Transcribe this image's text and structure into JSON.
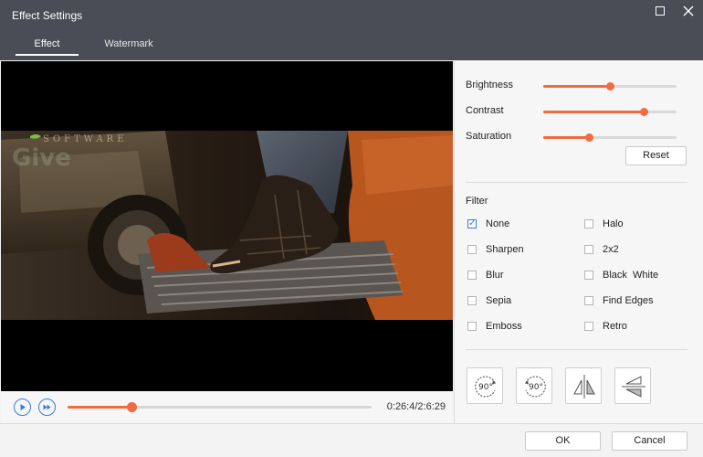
{
  "window": {
    "title": "Effect Settings",
    "maximize_icon": "maximize-icon",
    "close_icon": "close-icon"
  },
  "tabs": [
    {
      "label": "Effect",
      "active": true
    },
    {
      "label": "Watermark",
      "active": false
    }
  ],
  "watermark_overlay": {
    "text": "SOFTWARE",
    "accent": "#7bbf3a"
  },
  "player": {
    "play_icon": "play-icon",
    "step_icon": "step-forward-icon",
    "progress": 0.21,
    "time": "0:26:4/2:6:29"
  },
  "adjustments": {
    "brightness": {
      "label": "Brightness",
      "value": 0.5
    },
    "contrast": {
      "label": "Contrast",
      "value": 0.75
    },
    "saturation": {
      "label": "Saturation",
      "value": 0.34
    },
    "reset_label": "Reset"
  },
  "filter": {
    "heading": "Filter",
    "items": [
      {
        "label": "None",
        "checked": true
      },
      {
        "label": "Halo",
        "checked": false
      },
      {
        "label": "Sharpen",
        "checked": false
      },
      {
        "label": "2x2",
        "checked": false
      },
      {
        "label": "Blur",
        "checked": false
      },
      {
        "label": "Black  White",
        "checked": false
      },
      {
        "label": "Sepia",
        "checked": false
      },
      {
        "label": "Find Edges",
        "checked": false
      },
      {
        "label": "Emboss",
        "checked": false
      },
      {
        "label": "Retro",
        "checked": false
      }
    ]
  },
  "rotate": {
    "cw_label": "90°",
    "ccw_label": "90°",
    "icons": [
      "rotate-clockwise-icon",
      "rotate-counterclockwise-icon",
      "flip-horizontal-icon",
      "flip-vertical-icon"
    ]
  },
  "footer": {
    "ok_label": "OK",
    "cancel_label": "Cancel"
  },
  "colors": {
    "accent": "#f06b40",
    "link": "#3b7bd8",
    "titlebar": "#4a4d55"
  }
}
